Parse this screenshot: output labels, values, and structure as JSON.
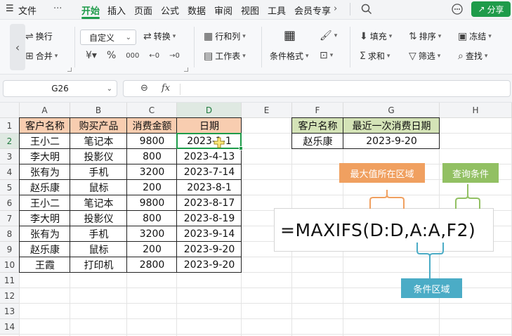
{
  "menu": {
    "file_label": "文件",
    "more": "···",
    "tabs": [
      "开始",
      "插入",
      "页面",
      "公式",
      "数据",
      "审阅",
      "视图",
      "工具",
      "会员专享"
    ],
    "share_label": "分享"
  },
  "ribbon": {
    "wrap": "换行",
    "merge": "合并",
    "number_format": "自定义",
    "convert": "转换",
    "rows_cols": "行和列",
    "worksheet": "工作表",
    "conditional_format": "条件格式",
    "fill": "填充",
    "sort": "排序",
    "freeze": "冻结",
    "sum": "求和",
    "filter": "筛选",
    "find": "查找"
  },
  "formula_bar": {
    "name_box": "G26",
    "fx": "fx",
    "value": ""
  },
  "columns": [
    "A",
    "B",
    "C",
    "D",
    "E",
    "F",
    "G",
    "H"
  ],
  "rows": [
    "1",
    "2",
    "3",
    "4",
    "5",
    "6",
    "7",
    "8",
    "9",
    "10",
    "11",
    "12",
    "13",
    "14"
  ],
  "table_headers": [
    "客户名称",
    "购买产品",
    "消费金额",
    "日期"
  ],
  "table_rows": [
    [
      "王小二",
      "笔记本",
      "9800",
      "2023-1-1"
    ],
    [
      "李大明",
      "投影仪",
      "800",
      "2023-4-13"
    ],
    [
      "张有为",
      "手机",
      "3200",
      "2023-7-14"
    ],
    [
      "赵乐康",
      "鼠标",
      "200",
      "2023-8-1"
    ],
    [
      "王小二",
      "笔记本",
      "9800",
      "2023-8-17"
    ],
    [
      "李大明",
      "投影仪",
      "800",
      "2023-8-19"
    ],
    [
      "张有为",
      "手机",
      "3200",
      "2023-9-14"
    ],
    [
      "赵乐康",
      "鼠标",
      "200",
      "2023-9-20"
    ],
    [
      "王霞",
      "打印机",
      "2800",
      "2023-9-20"
    ]
  ],
  "lookup": {
    "headers": [
      "客户名称",
      "最近一次消费日期"
    ],
    "values": [
      "赵乐康",
      "2023-9-20"
    ]
  },
  "annotation": {
    "formula": "=MAXIFS(D:D,A:A,F2)",
    "max_range_label": "最大值所在区域",
    "criteria_label": "查询条件",
    "criteria_range_label": "条件区域"
  },
  "colors": {
    "accent": "#1e9b4a",
    "orange_header": "#f8cdb0",
    "green_header": "#d4e3b7",
    "tag_orange": "#f0a060",
    "tag_green": "#92c063",
    "tag_blue": "#4bacc6"
  }
}
